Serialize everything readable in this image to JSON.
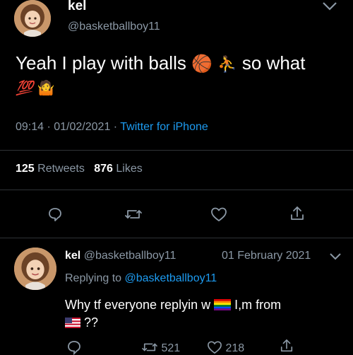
{
  "tweet": {
    "display_name": "kel",
    "handle": "@basketballboy11",
    "text_part1": "Yeah I play with balls",
    "text_part2": "so what",
    "emoji_basketball": "🏀",
    "emoji_player": "⛹",
    "emoji_hundred": "💯",
    "emoji_shrug": "🤷",
    "timestamp": "09:14 · 01/02/2021 ·",
    "source": "Twitter for iPhone",
    "retweets_count": "125",
    "retweets_label": "Retweets",
    "likes_count": "876",
    "likes_label": "Likes"
  },
  "reply": {
    "display_name": "kel",
    "handle": "@basketballboy11",
    "date": "01 February 2021",
    "replying_prefix": "Replying to",
    "replying_handle": "@basketballboy11",
    "text_line1_a": "Why tf everyone replyin w",
    "text_line1_b": "I,m from",
    "text_line2": "??",
    "retweets": "521",
    "likes": "218"
  },
  "colors": {
    "background": "#000000",
    "muted": "#8b98a5",
    "link": "#1d9bf0",
    "divider": "#2f3336"
  }
}
